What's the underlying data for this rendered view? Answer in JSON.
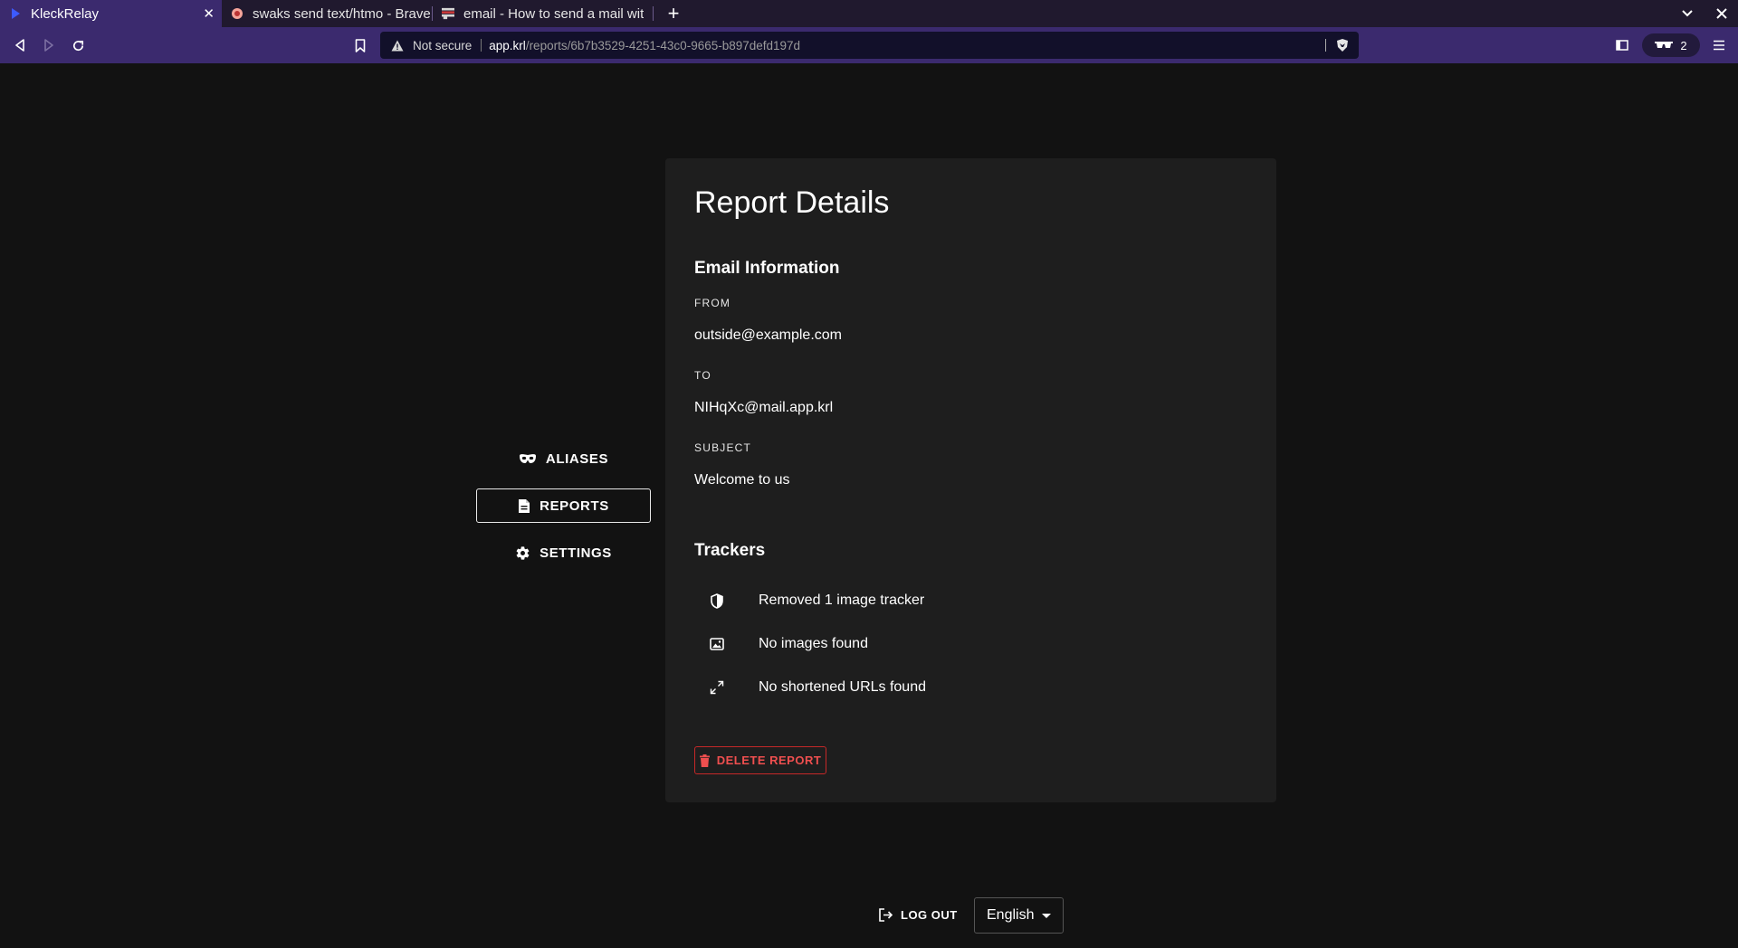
{
  "browser": {
    "tabs": [
      {
        "title": "KleckRelay",
        "active": true,
        "close": "✕"
      },
      {
        "title": "swaks send text/htmo - Brave",
        "active": false
      },
      {
        "title": "email - How to send a mail wit",
        "active": false
      }
    ],
    "new_tab": "+",
    "url": {
      "security_label": "Not secure",
      "host": "app.krl",
      "path": "/reports/6b7b3529-4251-43c0-9665-b897defd197d"
    },
    "shields_count": "2",
    "accent": "#3b2a6e"
  },
  "nav": {
    "items": [
      {
        "label": "ALIASES",
        "icon": "mask-icon",
        "active": false
      },
      {
        "label": "REPORTS",
        "icon": "document-icon",
        "active": true
      },
      {
        "label": "SETTINGS",
        "icon": "gear-icon",
        "active": false
      }
    ]
  },
  "report": {
    "title": "Report Details",
    "email_section": {
      "heading": "Email Information",
      "from_label": "FROM",
      "from_value": "outside@example.com",
      "to_label": "TO",
      "to_value": "NIHqXc@mail.app.krl",
      "subject_label": "SUBJECT",
      "subject_value": "Welcome to us"
    },
    "trackers_section": {
      "heading": "Trackers",
      "items": [
        {
          "text": "Removed 1 image tracker",
          "icon": "shield-icon"
        },
        {
          "text": "No images found",
          "icon": "image-icon"
        },
        {
          "text": "No shortened URLs found",
          "icon": "expand-icon"
        }
      ]
    },
    "delete_label": "DELETE REPORT",
    "danger_color": "#ef4f4f"
  },
  "footer": {
    "logout_label": "LOG OUT",
    "language": "English"
  }
}
